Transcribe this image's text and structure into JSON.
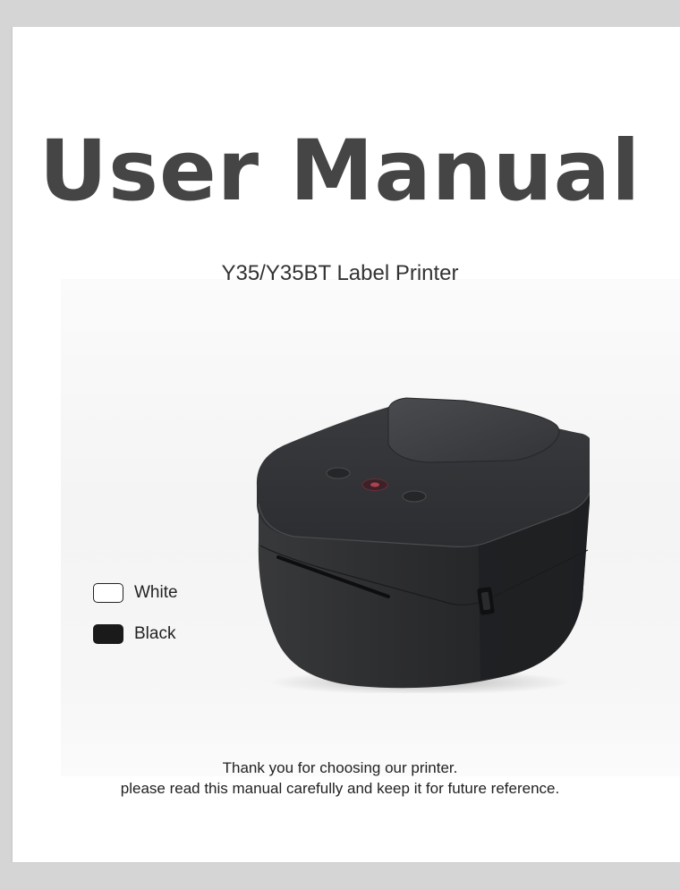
{
  "document": {
    "title": "User Manual",
    "subtitle": "Y35/Y35BT Label Printer",
    "color_options": [
      {
        "label": "White",
        "swatch": "#ffffff"
      },
      {
        "label": "Black",
        "swatch": "#1a1a1a"
      }
    ],
    "footer_line1": "Thank you for choosing our printer.",
    "footer_line2": "please read this manual carefully and keep it for future reference."
  },
  "colors": {
    "title": "#454545",
    "printer_body": "#2b2c2e",
    "viewer_bg": "#d5d5d5"
  }
}
